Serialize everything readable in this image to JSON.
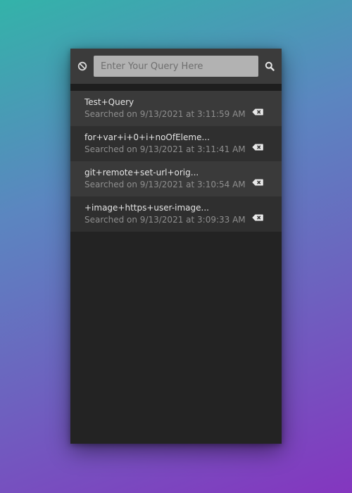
{
  "toolbar": {
    "block_icon": "block-icon",
    "search_placeholder": "Enter Your Query Here",
    "search_value": "",
    "search_icon": "search-icon"
  },
  "history": {
    "items": [
      {
        "query": "Test+Query",
        "searched": "Searched on 9/13/2021 at 3:11:59 AM",
        "delete_icon": "backspace-icon"
      },
      {
        "query": "for+var+i+0+i+noOfEleme...",
        "searched": "Searched on 9/13/2021 at 3:11:41 AM",
        "delete_icon": "backspace-icon"
      },
      {
        "query": "git+remote+set-url+orig...",
        "searched": "Searched on 9/13/2021 at 3:10:54 AM",
        "delete_icon": "backspace-icon"
      },
      {
        "query": "+image+https+user-image...",
        "searched": "Searched on 9/13/2021 at 3:09:33 AM",
        "delete_icon": "backspace-icon"
      }
    ]
  },
  "colors": {
    "panel_bg": "#232323",
    "toolbar_bg": "#3b3b3b",
    "input_bg": "#b2b2b2",
    "row_odd": "#3a3a3a",
    "row_even": "#2f2f2f",
    "query_text": "#e4e4e4",
    "time_text": "#8e8e8e"
  }
}
